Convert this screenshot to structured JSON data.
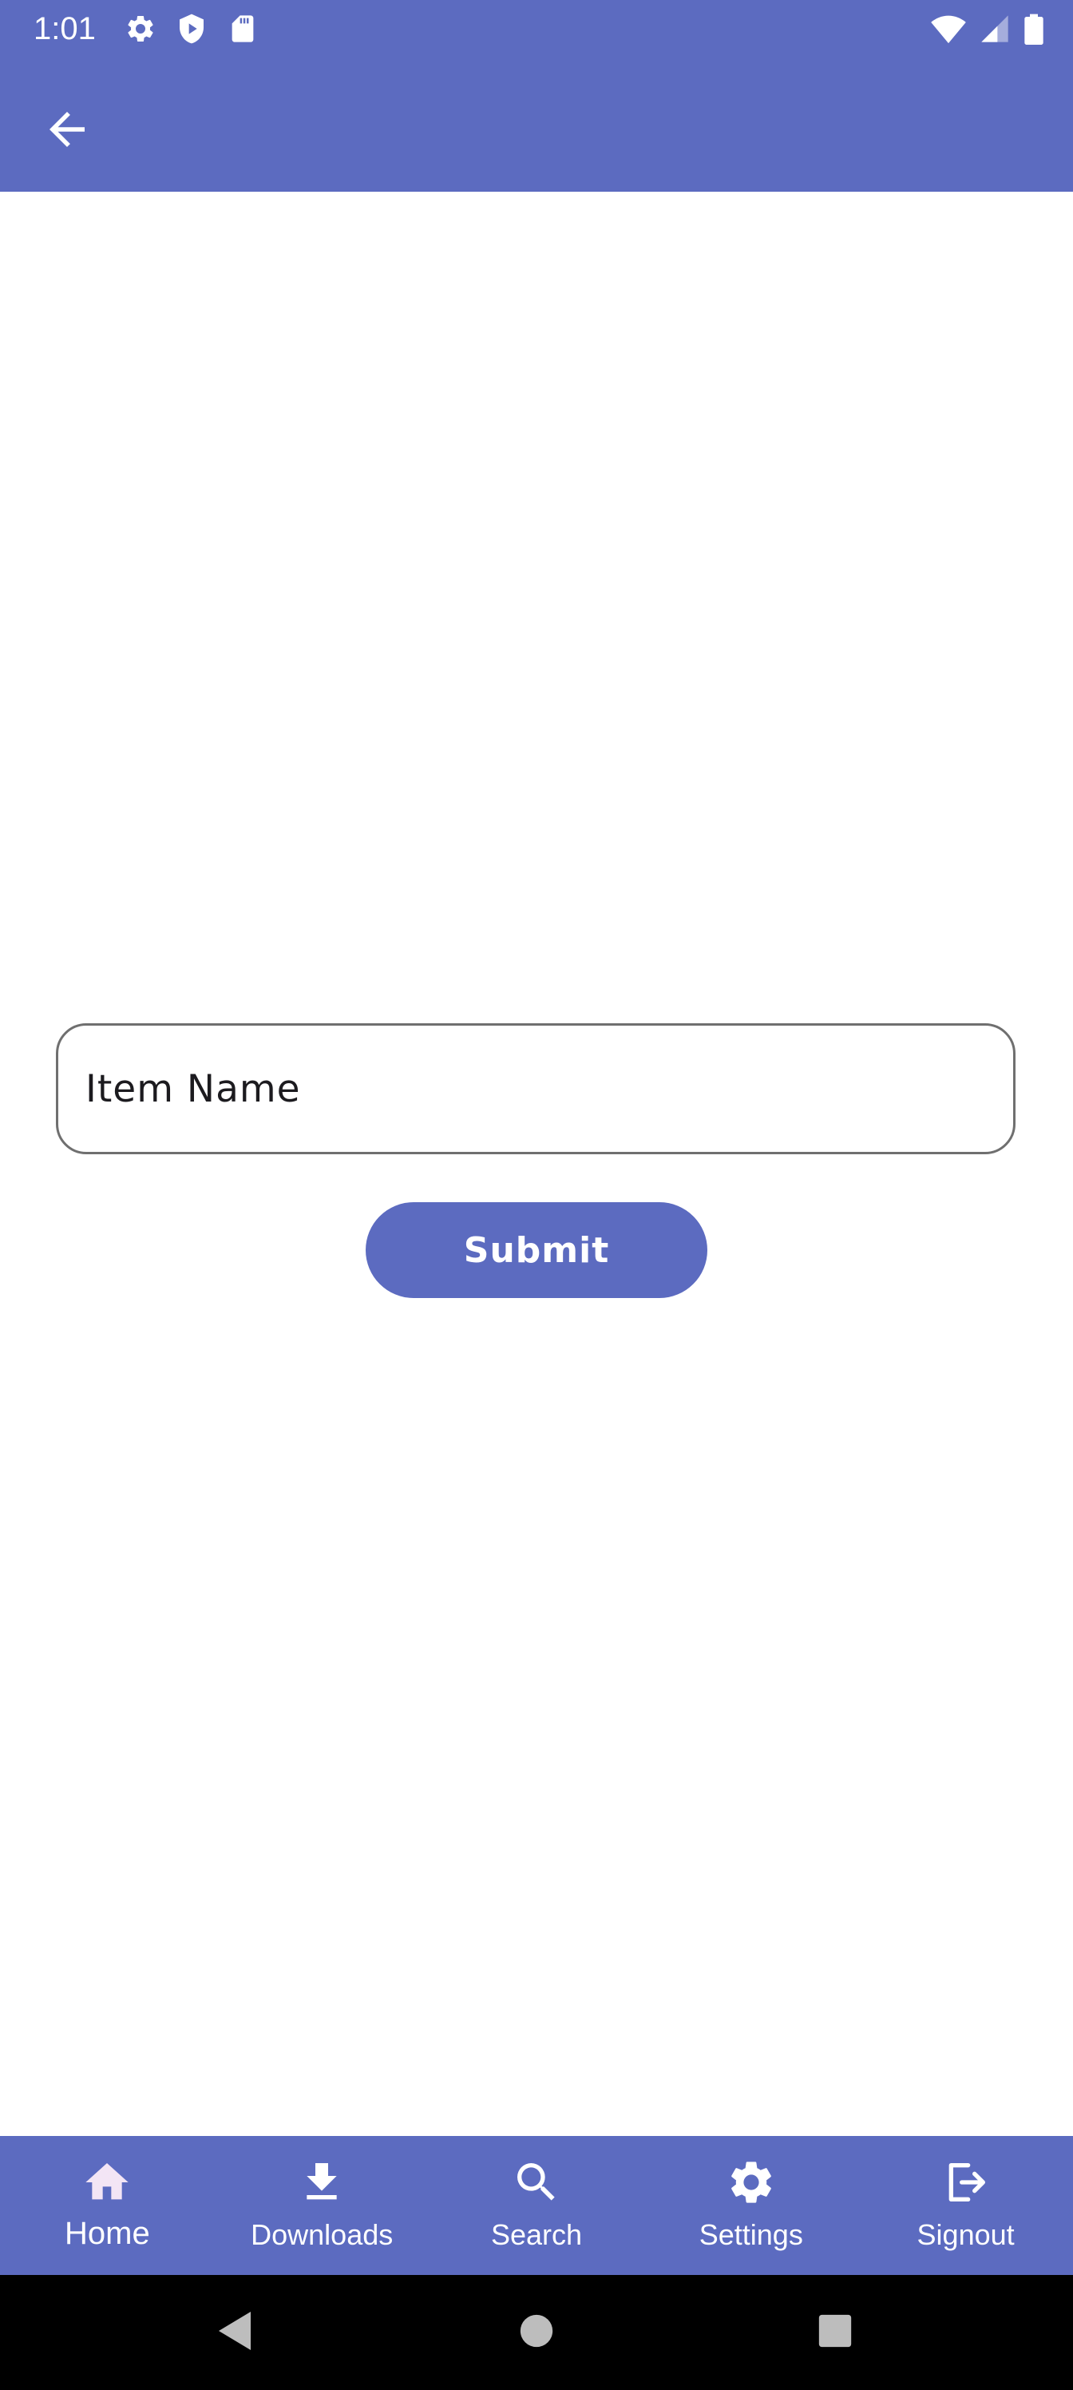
{
  "status_bar": {
    "time": "1:01",
    "left_icons": [
      "gear-icon",
      "shield-play-icon",
      "sd-card-icon"
    ],
    "right_icons": [
      "wifi-icon",
      "cell-signal-icon",
      "battery-icon"
    ]
  },
  "app_bar": {
    "back_icon": "arrow-back-icon"
  },
  "form": {
    "item_name_placeholder": "Item Name",
    "item_name_value": "",
    "submit_label": "Submit"
  },
  "bottom_nav": {
    "items": [
      {
        "label": "Home",
        "icon": "home-icon",
        "active": true
      },
      {
        "label": "Downloads",
        "icon": "download-icon",
        "active": false
      },
      {
        "label": "Search",
        "icon": "search-icon",
        "active": false
      },
      {
        "label": "Settings",
        "icon": "gear-icon",
        "active": false
      },
      {
        "label": "Signout",
        "icon": "logout-icon",
        "active": false
      }
    ]
  },
  "system_nav": {
    "buttons": [
      "back-triangle-icon",
      "home-circle-icon",
      "recents-square-icon"
    ]
  },
  "colors": {
    "primary": "#5c6bc0",
    "active_icon": "#f3e5f5",
    "field_border": "#6f6f6f",
    "background": "#ffffff",
    "system_nav": "#000000"
  }
}
